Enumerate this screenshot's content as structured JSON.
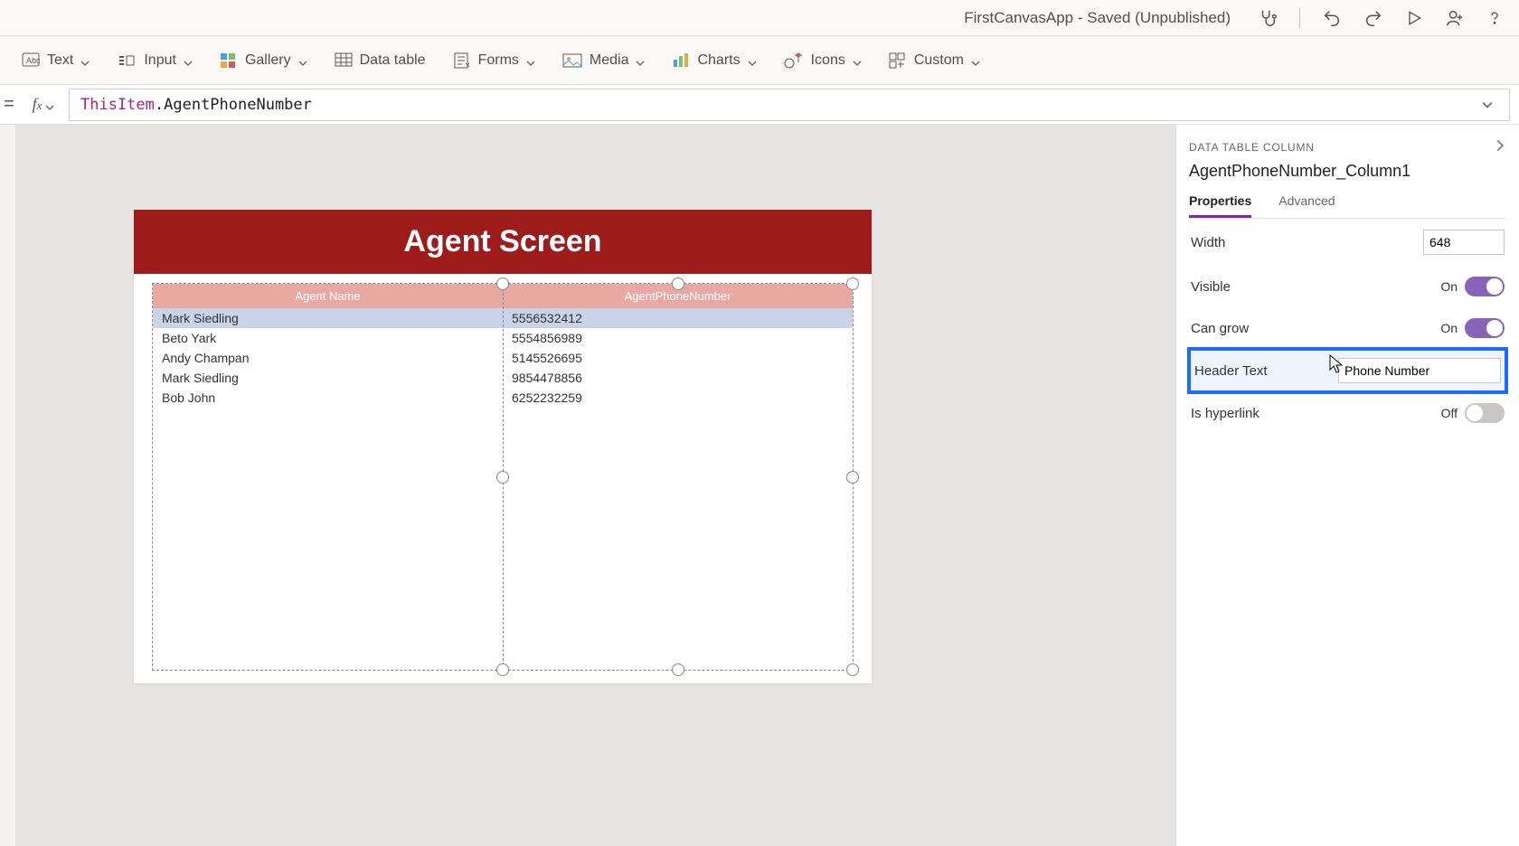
{
  "titlebar": {
    "title": "FirstCanvasApp - Saved (Unpublished)"
  },
  "ribbon": {
    "text": "Text",
    "input": "Input",
    "gallery": "Gallery",
    "data_table": "Data table",
    "forms": "Forms",
    "media": "Media",
    "charts": "Charts",
    "icons": "Icons",
    "custom": "Custom"
  },
  "formula": {
    "this": "ThisItem",
    "rest": ".AgentPhoneNumber"
  },
  "properties": {
    "panel_label": "DATA TABLE COLUMN",
    "selected_name": "AgentPhoneNumber_Column1",
    "tabs": {
      "properties": "Properties",
      "advanced": "Advanced"
    },
    "width_label": "Width",
    "width_value": "648",
    "visible_label": "Visible",
    "visible_state": "On",
    "cangrow_label": "Can grow",
    "cangrow_state": "On",
    "headertext_label": "Header Text",
    "headertext_value": "Phone Number",
    "hyperlink_label": "Is hyperlink",
    "hyperlink_state": "Off"
  },
  "app": {
    "title": "Agent Screen",
    "columns": {
      "name": "Agent Name",
      "phone": "AgentPhoneNumber"
    },
    "rows": [
      {
        "name": "Mark Siedling",
        "phone": "5556532412"
      },
      {
        "name": "Beto Yark",
        "phone": "5554856989"
      },
      {
        "name": "Andy Champan",
        "phone": "5145526695"
      },
      {
        "name": "Mark Siedling",
        "phone": "9854478856"
      },
      {
        "name": "Bob John",
        "phone": "6252232259"
      }
    ]
  }
}
